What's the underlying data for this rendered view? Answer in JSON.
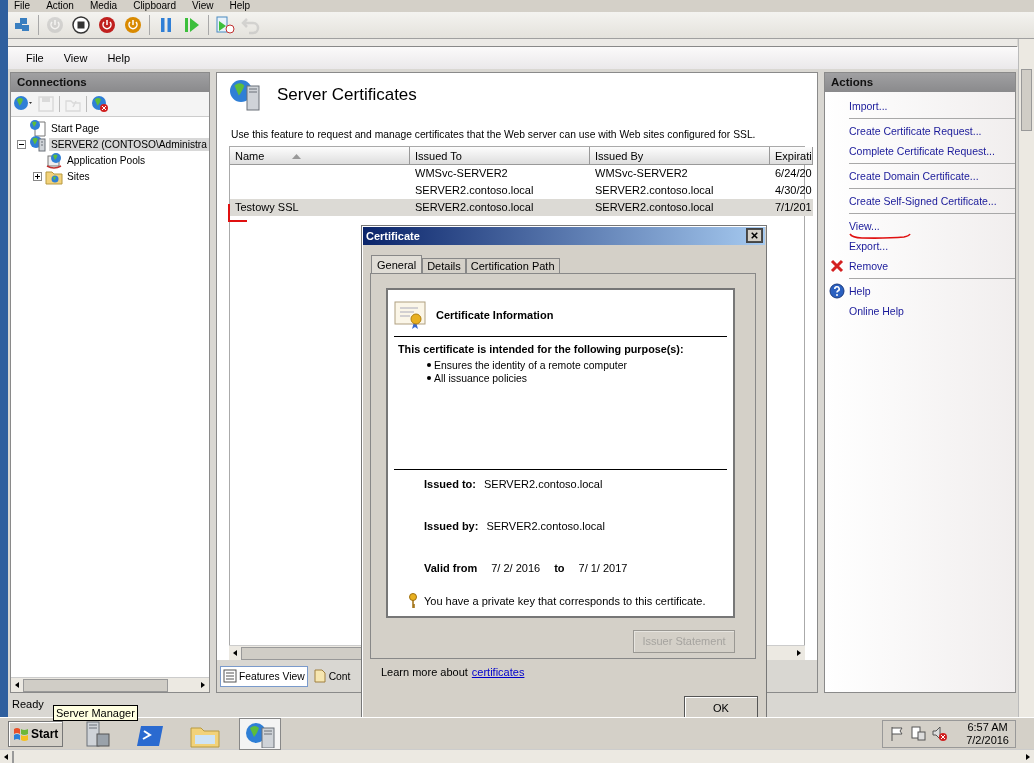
{
  "vm_menu": [
    "File",
    "Action",
    "Media",
    "Clipboard",
    "View",
    "Help"
  ],
  "vm_toolbar": [
    {
      "kind": "keys",
      "disabled": false
    },
    {
      "kind": "start",
      "disabled": true
    },
    {
      "kind": "turn-off",
      "disabled": false
    },
    {
      "kind": "shutdown",
      "disabled": false
    },
    {
      "kind": "save",
      "disabled": false
    },
    {
      "kind": "pause",
      "disabled": false
    },
    {
      "kind": "resume",
      "disabled": false
    },
    {
      "kind": "checkpoint",
      "disabled": false
    },
    {
      "kind": "revert",
      "disabled": true
    }
  ],
  "menu": [
    "File",
    "View",
    "Help"
  ],
  "connections": {
    "title": "Connections",
    "toolbar": [
      {
        "kind": "connect",
        "disabled": false
      },
      {
        "kind": "save",
        "disabled": true
      },
      {
        "kind": "up",
        "disabled": true
      },
      {
        "kind": "disconnect",
        "disabled": false
      }
    ],
    "tree": [
      {
        "label": "Start Page",
        "kind": "start",
        "selected": false
      },
      {
        "label": "SERVER2 (CONTOSO\\Administra",
        "kind": "server",
        "selected": true,
        "expanded": true,
        "children": [
          {
            "label": "Application Pools",
            "kind": "pools",
            "selected": false
          },
          {
            "label": "Sites",
            "kind": "sites",
            "selected": false,
            "expanded": false
          }
        ]
      }
    ]
  },
  "center": {
    "title": "Server Certificates",
    "description": "Use this feature to request and manage certificates that the Web server can use with Web sites configured for SSL.",
    "columns": [
      {
        "label": "Name",
        "sorted": true
      },
      {
        "label": "Issued To",
        "sorted": false
      },
      {
        "label": "Issued By",
        "sorted": false
      },
      {
        "label": "Expirati",
        "sorted": false
      }
    ],
    "rows": [
      {
        "issued_to": "WMSvc-SERVER2",
        "issued_by": "WMSvc-SERVER2",
        "expiration": "6/24/20",
        "selected": false
      },
      {
        "issued_to": "SERVER2.contoso.local",
        "issued_by": "SERVER2.contoso.local",
        "expiration": "4/30/20",
        "selected": false
      },
      {
        "name": "Testowy SSL",
        "issued_to": "SERVER2.contoso.local",
        "issued_by": "SERVER2.contoso.local",
        "expiration": "7/1/201",
        "selected": true
      }
    ],
    "view_tabs": [
      {
        "label": "Features View",
        "selected": true
      },
      {
        "label": "Cont",
        "selected": false
      }
    ]
  },
  "actions": {
    "title": "Actions",
    "groups": [
      [
        {
          "label": "Import...",
          "kind": "link"
        }
      ],
      [
        {
          "label": "Create Certificate Request...",
          "kind": "link"
        },
        {
          "label": "Complete Certificate Request...",
          "kind": "link"
        }
      ],
      [
        {
          "label": "Create Domain Certificate...",
          "kind": "link"
        }
      ],
      [
        {
          "label": "Create Self-Signed Certificate...",
          "kind": "link"
        }
      ],
      [
        {
          "label": "View...",
          "kind": "link"
        },
        {
          "label": "Export...",
          "kind": "link"
        },
        {
          "label": "Remove",
          "kind": "remove"
        }
      ],
      [
        {
          "label": "Help",
          "kind": "help"
        },
        {
          "label": "Online Help",
          "kind": "link"
        }
      ]
    ]
  },
  "status_bar": "Ready",
  "tooltip": "Server Manager",
  "dialog": {
    "title": "Certificate",
    "tabs": [
      {
        "label": "General",
        "selected": true
      },
      {
        "label": "Details",
        "selected": false
      },
      {
        "label": "Certification Path",
        "selected": false
      }
    ],
    "info_title": "Certificate Information",
    "purpose_heading": "This certificate is intended for the following purpose(s):",
    "purposes": [
      "Ensures the identity of a remote computer",
      "All issuance policies"
    ],
    "fields": [
      {
        "label": "Issued to:",
        "value": "SERVER2.contoso.local"
      },
      {
        "label": "Issued by:",
        "value": "SERVER2.contoso.local"
      }
    ],
    "valid": {
      "from_label": "Valid from",
      "from": "7/ 2/ 2016",
      "to_label": "to",
      "to": "7/ 1/ 2017"
    },
    "key_note": "You have a private key that corresponds to this certificate.",
    "issuer_button": {
      "label": "Issuer Statement",
      "disabled": true
    },
    "learn_more": "Learn more about",
    "learn_more_link": "certificates",
    "ok": "OK"
  },
  "taskbar": {
    "start": "Start",
    "apps": [
      {
        "kind": "server-manager",
        "selected": false
      },
      {
        "kind": "powershell",
        "selected": false
      },
      {
        "kind": "explorer",
        "selected": false
      },
      {
        "kind": "iis",
        "selected": true
      }
    ],
    "tray": [
      {
        "kind": "flag"
      },
      {
        "kind": "network"
      },
      {
        "kind": "muted"
      }
    ],
    "time": "6:57 AM",
    "date": "7/2/2016"
  },
  "annotations": [
    {
      "kind": "corner"
    },
    {
      "kind": "underline"
    }
  ]
}
